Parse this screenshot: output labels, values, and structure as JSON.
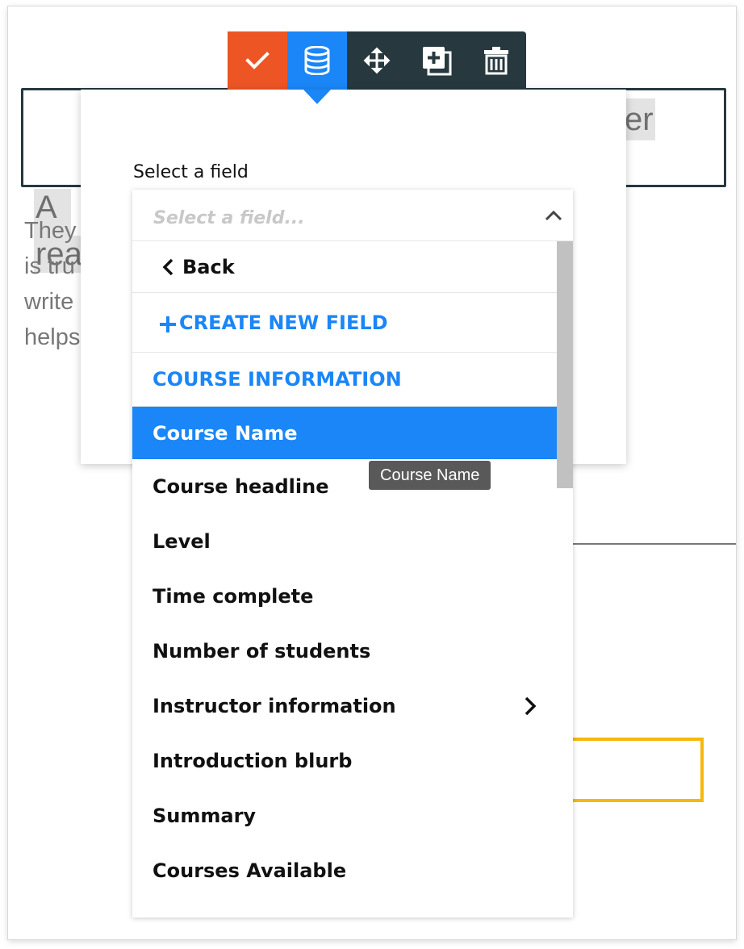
{
  "background_page": {
    "heading_line1": "A su",
    "heading_line2": "reas",
    "heading_tail": "er",
    "paragraph_lines": [
      "They",
      "is tru",
      "write",
      "helps"
    ]
  },
  "toolbar": {
    "buttons": [
      {
        "name": "check-icon"
      },
      {
        "name": "database-icon"
      },
      {
        "name": "move-icon"
      },
      {
        "name": "duplicate-icon"
      },
      {
        "name": "trash-icon"
      }
    ],
    "colors": {
      "confirm": "#ed5525",
      "active": "#1a86f7",
      "bar": "#27383f"
    }
  },
  "panel": {
    "label": "Select a field"
  },
  "dropdown": {
    "placeholder": "Select a field...",
    "back_label": "Back",
    "create_label": "CREATE NEW FIELD",
    "group_label": "COURSE INFORMATION",
    "items": [
      {
        "label": "Course Name",
        "selected": true
      },
      {
        "label": "Course headline"
      },
      {
        "label": "Level"
      },
      {
        "label": "Time complete"
      },
      {
        "label": "Number of students"
      },
      {
        "label": "Instructor information",
        "has_submenu": true
      },
      {
        "label": "Introduction blurb"
      },
      {
        "label": "Summary"
      },
      {
        "label": "Courses Available"
      }
    ],
    "accent_color": "#1a86f7"
  },
  "tooltip": {
    "text": "Course Name"
  }
}
